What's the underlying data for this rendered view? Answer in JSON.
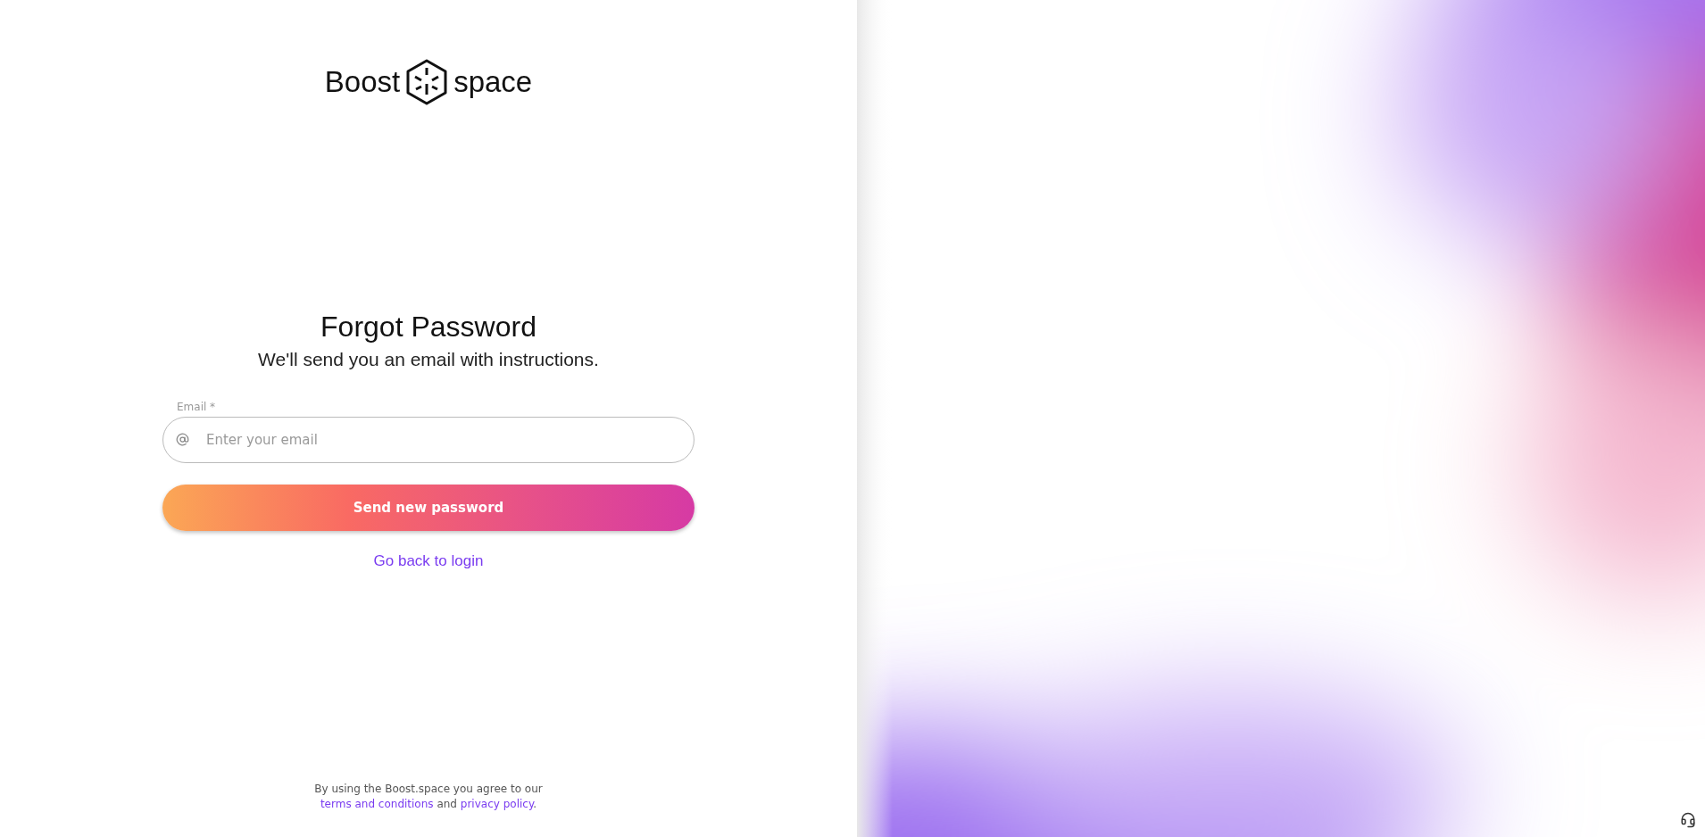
{
  "logo": {
    "word_left": "Boost",
    "word_right": "space"
  },
  "heading": "Forgot Password",
  "subheading": "We'll send you an email with instructions.",
  "email_field": {
    "label": "Email *",
    "placeholder": "Enter your email"
  },
  "submit_button": "Send new password",
  "back_link": "Go back to login",
  "footer": {
    "text_before": "By using the Boost.space you agree to our",
    "terms_link": "terms and conditions",
    "text_middle": "and",
    "privacy_link": "privacy policy",
    "text_after": "."
  }
}
